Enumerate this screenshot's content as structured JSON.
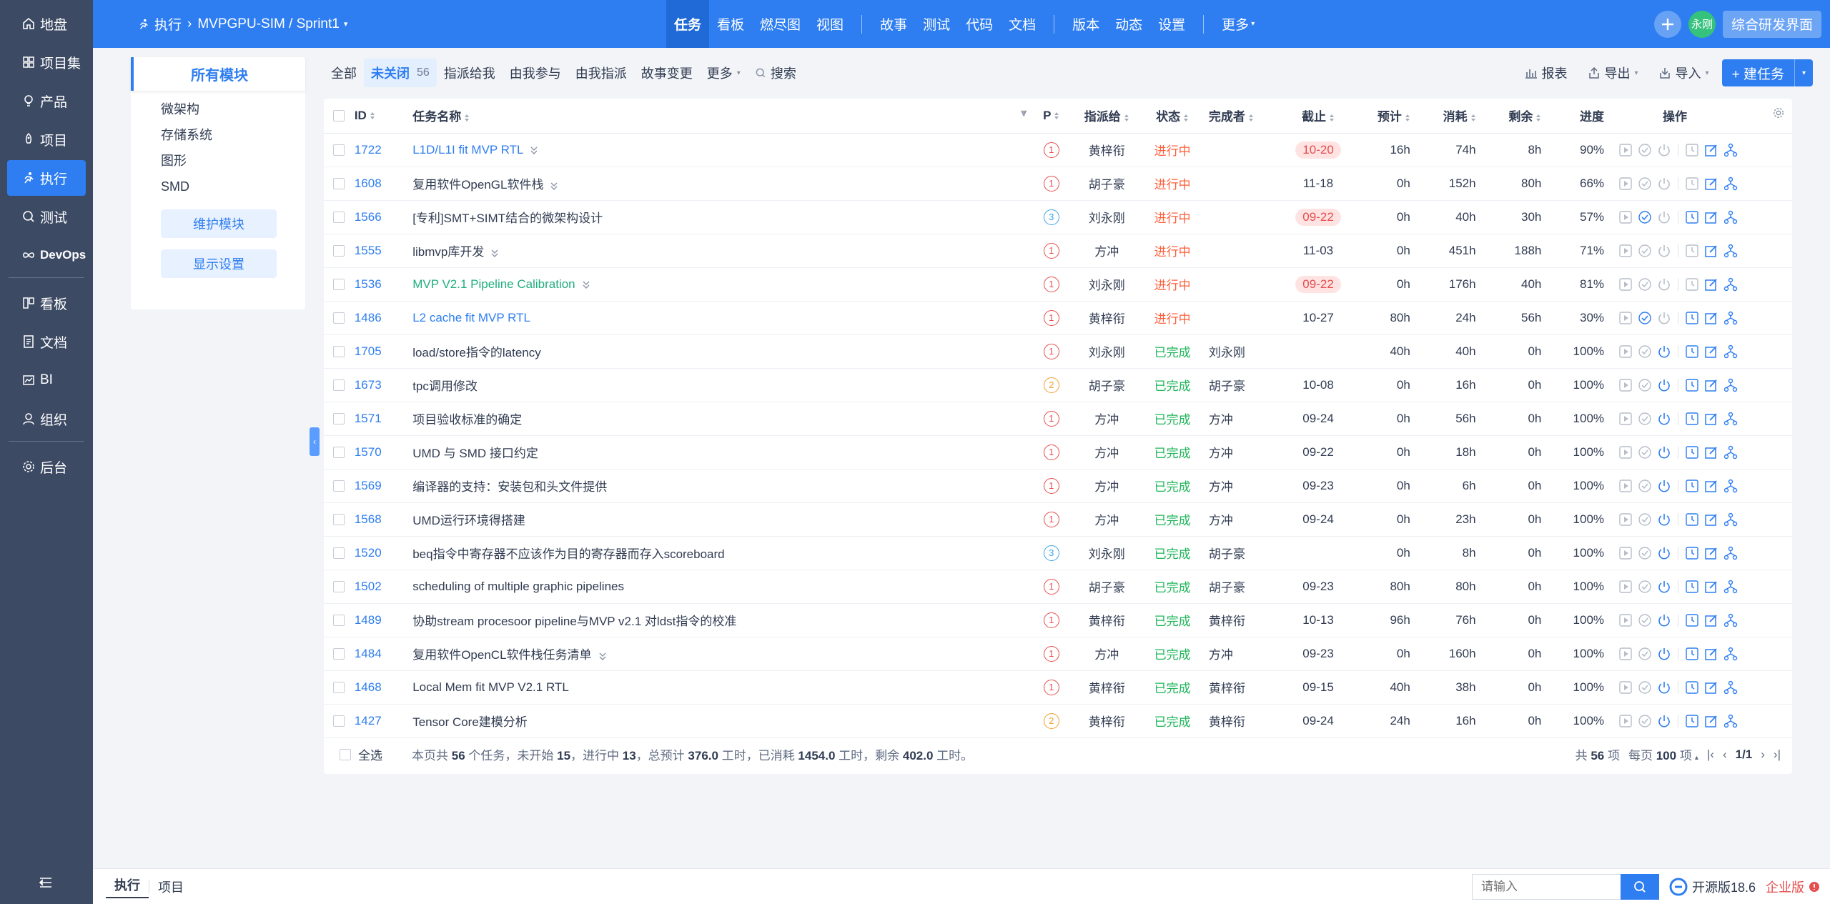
{
  "sidebar": {
    "items": [
      {
        "label": "地盘",
        "icon": "home-icon"
      },
      {
        "label": "项目集",
        "icon": "grid-icon"
      },
      {
        "label": "产品",
        "icon": "bulb-icon"
      },
      {
        "label": "项目",
        "icon": "rocket-icon"
      },
      {
        "label": "执行",
        "icon": "run-icon",
        "active": true
      },
      {
        "label": "测试",
        "icon": "search-icon"
      },
      {
        "label": "DevOps",
        "icon": "infinity-icon"
      },
      {
        "label": "看板",
        "icon": "board-icon"
      },
      {
        "label": "文档",
        "icon": "doc-icon"
      },
      {
        "label": "BI",
        "icon": "chart-icon"
      },
      {
        "label": "组织",
        "icon": "user-icon"
      },
      {
        "label": "后台",
        "icon": "gear-icon"
      }
    ]
  },
  "header": {
    "crumb_app": "执行",
    "crumb_path": "MVPGPU-SIM / Sprint1",
    "nav": [
      "任务",
      "看板",
      "燃尽图",
      "视图",
      "故事",
      "测试",
      "代码",
      "文档",
      "版本",
      "动态",
      "设置",
      "更多"
    ],
    "avatar": "永刚",
    "integrated": "综合研发界面"
  },
  "module_panel": {
    "title": "所有模块",
    "items": [
      "微架构",
      "存储系统",
      "图形",
      "SMD"
    ],
    "maintain": "维护模块",
    "display": "显示设置"
  },
  "toolbar": {
    "tabs": [
      {
        "label": "全部"
      },
      {
        "label": "未关闭",
        "count": "56",
        "active": true
      },
      {
        "label": "指派给我"
      },
      {
        "label": "由我参与"
      },
      {
        "label": "由我指派"
      },
      {
        "label": "故事变更"
      },
      {
        "label": "更多"
      },
      {
        "label": "搜索"
      }
    ],
    "report": "报表",
    "export": "导出",
    "import": "导入",
    "create": "建任务"
  },
  "table": {
    "headers": {
      "id": "ID",
      "name": "任务名称",
      "pri": "P",
      "assigned": "指派给",
      "status": "状态",
      "finished_by": "完成者",
      "deadline": "截止",
      "estimate": "预计",
      "consumed": "消耗",
      "left": "剩余",
      "progress": "进度",
      "actions": "操作"
    },
    "rows": [
      {
        "id": "1722",
        "name": "L1D/L1I fit MVP RTL",
        "name_color": "blue",
        "expand": true,
        "pri": "1",
        "assigned": "黄梓衔",
        "status": "进行中",
        "finished_by": "",
        "deadline": "10-20",
        "dl_red": true,
        "estimate": "16h",
        "consumed": "74h",
        "left": "8h",
        "progress": "90%"
      },
      {
        "id": "1608",
        "name": "复用软件OpenGL软件栈",
        "name_color": "",
        "expand": true,
        "pri": "1",
        "assigned": "胡子豪",
        "status": "进行中",
        "finished_by": "",
        "deadline": "11-18",
        "dl_red": false,
        "estimate": "0h",
        "consumed": "152h",
        "left": "80h",
        "progress": "66%"
      },
      {
        "id": "1566",
        "name": "[专利]SMT+SIMT结合的微架构设计",
        "name_color": "",
        "expand": false,
        "pri": "3",
        "assigned": "刘永刚",
        "status": "进行中",
        "finished_by": "",
        "deadline": "09-22",
        "dl_red": true,
        "estimate": "0h",
        "consumed": "40h",
        "left": "30h",
        "progress": "57%"
      },
      {
        "id": "1555",
        "name": "libmvp库开发",
        "name_color": "",
        "expand": true,
        "pri": "1",
        "assigned": "方冲",
        "status": "进行中",
        "finished_by": "",
        "deadline": "11-03",
        "dl_red": false,
        "estimate": "0h",
        "consumed": "451h",
        "left": "188h",
        "progress": "71%"
      },
      {
        "id": "1536",
        "name": "MVP V2.1 Pipeline Calibration",
        "name_color": "green",
        "expand": true,
        "pri": "1",
        "assigned": "刘永刚",
        "status": "进行中",
        "finished_by": "",
        "deadline": "09-22",
        "dl_red": true,
        "estimate": "0h",
        "consumed": "176h",
        "left": "40h",
        "progress": "81%"
      },
      {
        "id": "1486",
        "name": "L2 cache fit MVP RTL",
        "name_color": "blue",
        "expand": false,
        "pri": "1",
        "assigned": "黄梓衔",
        "status": "进行中",
        "finished_by": "",
        "deadline": "10-27",
        "dl_red": false,
        "estimate": "80h",
        "consumed": "24h",
        "left": "56h",
        "progress": "30%"
      },
      {
        "id": "1705",
        "name": "load/store指令的latency",
        "name_color": "",
        "expand": false,
        "pri": "1",
        "assigned": "刘永刚",
        "status": "已完成",
        "finished_by": "刘永刚",
        "deadline": "",
        "dl_red": false,
        "estimate": "40h",
        "consumed": "40h",
        "left": "0h",
        "progress": "100%"
      },
      {
        "id": "1673",
        "name": "tpc调用修改",
        "name_color": "",
        "expand": false,
        "pri": "2",
        "assigned": "胡子豪",
        "status": "已完成",
        "finished_by": "胡子豪",
        "deadline": "10-08",
        "dl_red": false,
        "estimate": "0h",
        "consumed": "16h",
        "left": "0h",
        "progress": "100%"
      },
      {
        "id": "1571",
        "name": "项目验收标准的确定",
        "name_color": "",
        "expand": false,
        "pri": "1",
        "assigned": "方冲",
        "status": "已完成",
        "finished_by": "方冲",
        "deadline": "09-24",
        "dl_red": false,
        "estimate": "0h",
        "consumed": "56h",
        "left": "0h",
        "progress": "100%"
      },
      {
        "id": "1570",
        "name": "UMD 与 SMD 接口约定",
        "name_color": "",
        "expand": false,
        "pri": "1",
        "assigned": "方冲",
        "status": "已完成",
        "finished_by": "方冲",
        "deadline": "09-22",
        "dl_red": false,
        "estimate": "0h",
        "consumed": "18h",
        "left": "0h",
        "progress": "100%"
      },
      {
        "id": "1569",
        "name": "编译器的支持：安装包和头文件提供",
        "name_color": "",
        "expand": false,
        "pri": "1",
        "assigned": "方冲",
        "status": "已完成",
        "finished_by": "方冲",
        "deadline": "09-23",
        "dl_red": false,
        "estimate": "0h",
        "consumed": "6h",
        "left": "0h",
        "progress": "100%"
      },
      {
        "id": "1568",
        "name": "UMD运行环境得搭建",
        "name_color": "",
        "expand": false,
        "pri": "1",
        "assigned": "方冲",
        "status": "已完成",
        "finished_by": "方冲",
        "deadline": "09-24",
        "dl_red": false,
        "estimate": "0h",
        "consumed": "23h",
        "left": "0h",
        "progress": "100%"
      },
      {
        "id": "1520",
        "name": "beq指令中寄存器不应该作为目的寄存器而存入scoreboard",
        "name_color": "",
        "expand": false,
        "pri": "3",
        "assigned": "刘永刚",
        "status": "已完成",
        "finished_by": "胡子豪",
        "deadline": "",
        "dl_red": false,
        "estimate": "0h",
        "consumed": "8h",
        "left": "0h",
        "progress": "100%"
      },
      {
        "id": "1502",
        "name": "scheduling of multiple graphic pipelines",
        "name_color": "",
        "expand": false,
        "pri": "1",
        "assigned": "胡子豪",
        "status": "已完成",
        "finished_by": "胡子豪",
        "deadline": "09-23",
        "dl_red": false,
        "estimate": "80h",
        "consumed": "80h",
        "left": "0h",
        "progress": "100%"
      },
      {
        "id": "1489",
        "name": "协助stream procesoor pipeline与MVP v2.1 对ldst指令的校准",
        "name_color": "",
        "expand": false,
        "pri": "1",
        "assigned": "黄梓衔",
        "status": "已完成",
        "finished_by": "黄梓衔",
        "deadline": "10-13",
        "dl_red": false,
        "estimate": "96h",
        "consumed": "76h",
        "left": "0h",
        "progress": "100%"
      },
      {
        "id": "1484",
        "name": "复用软件OpenCL软件栈任务清单",
        "name_color": "",
        "expand": true,
        "pri": "1",
        "assigned": "方冲",
        "status": "已完成",
        "finished_by": "方冲",
        "deadline": "09-23",
        "dl_red": false,
        "estimate": "0h",
        "consumed": "160h",
        "left": "0h",
        "progress": "100%"
      },
      {
        "id": "1468",
        "name": "Local Mem fit MVP V2.1 RTL",
        "name_color": "",
        "expand": false,
        "pri": "1",
        "assigned": "黄梓衔",
        "status": "已完成",
        "finished_by": "黄梓衔",
        "deadline": "09-15",
        "dl_red": false,
        "estimate": "40h",
        "consumed": "38h",
        "left": "0h",
        "progress": "100%"
      },
      {
        "id": "1427",
        "name": "Tensor Core建模分析",
        "name_color": "",
        "expand": false,
        "pri": "2",
        "assigned": "黄梓衔",
        "status": "已完成",
        "finished_by": "黄梓衔",
        "deadline": "09-24",
        "dl_red": false,
        "estimate": "24h",
        "consumed": "16h",
        "left": "0h",
        "progress": "100%"
      }
    ],
    "footer": {
      "select_all": "全选",
      "s1": "本页共 ",
      "total": "56",
      "s2": " 个任务，未开始 ",
      "not_started": "15",
      "s3": "，进行中 ",
      "doing": "13",
      "s4": "，总预计 ",
      "est": "376.0",
      "s5": " 工时，已消耗 ",
      "con": "1454.0",
      "s6": " 工时，剩余 ",
      "rem": "402.0",
      "s7": " 工时。"
    },
    "pager": {
      "t1": "共 ",
      "total": "56",
      "t2": " 项",
      "p1": "每页 ",
      "per": "100",
      "p2": " 项",
      "page": "1/1"
    }
  },
  "bottombar": {
    "tabs": [
      "执行",
      "项目"
    ],
    "search_placeholder": "请输入",
    "version": "开源版18.6",
    "edition": "企业版"
  },
  "colors": {
    "primary": "#2e7ef1",
    "sidebar": "#3c4a64",
    "doing": "#ff5e3a",
    "done": "#1cb558",
    "danger": "#e64d4d"
  }
}
